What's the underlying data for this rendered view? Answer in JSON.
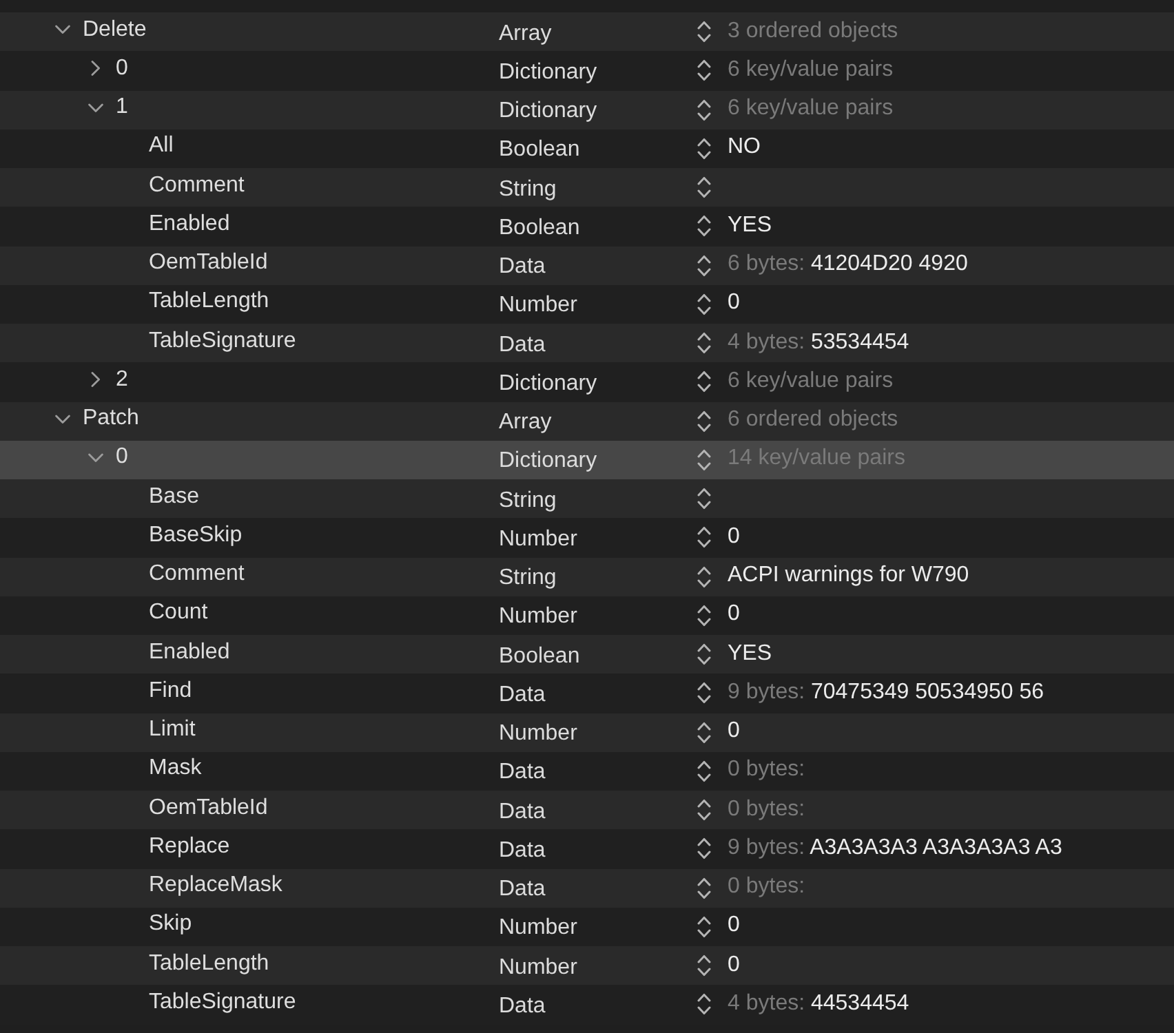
{
  "outline": {
    "rows": [
      {
        "key": "Delete",
        "type": "Array",
        "summary": "3 ordered objects",
        "expanded": true,
        "selected": false,
        "children": [
          {
            "key": "0",
            "type": "Dictionary",
            "summary": "6 key/value pairs",
            "expanded": false,
            "selected": false
          },
          {
            "key": "1",
            "type": "Dictionary",
            "summary": "6 key/value pairs",
            "expanded": true,
            "selected": false,
            "children": [
              {
                "key": "All",
                "type": "Boolean",
                "value": "NO",
                "selected": false
              },
              {
                "key": "Comment",
                "type": "String",
                "selected": false
              },
              {
                "key": "Enabled",
                "type": "Boolean",
                "value": "YES",
                "selected": false
              },
              {
                "key": "OemTableId",
                "type": "Data",
                "byte_count": "6 bytes:",
                "value": "41204D20 4920",
                "selected": false
              },
              {
                "key": "TableLength",
                "type": "Number",
                "value": "0",
                "selected": false
              },
              {
                "key": "TableSignature",
                "type": "Data",
                "byte_count": "4 bytes:",
                "value": "53534454",
                "selected": false
              }
            ]
          },
          {
            "key": "2",
            "type": "Dictionary",
            "summary": "6 key/value pairs",
            "expanded": false,
            "selected": false
          }
        ]
      },
      {
        "key": "Patch",
        "type": "Array",
        "summary": "6 ordered objects",
        "expanded": true,
        "selected": false,
        "children": [
          {
            "key": "0",
            "type": "Dictionary",
            "summary": "14 key/value pairs",
            "expanded": true,
            "selected": true,
            "children": [
              {
                "key": "Base",
                "type": "String",
                "selected": false
              },
              {
                "key": "BaseSkip",
                "type": "Number",
                "value": "0",
                "selected": false
              },
              {
                "key": "Comment",
                "type": "String",
                "value": "ACPI warnings for W790",
                "selected": false
              },
              {
                "key": "Count",
                "type": "Number",
                "value": "0",
                "selected": false
              },
              {
                "key": "Enabled",
                "type": "Boolean",
                "value": "YES",
                "selected": false
              },
              {
                "key": "Find",
                "type": "Data",
                "byte_count": "9 bytes:",
                "value": "70475349 50534950 56",
                "selected": false
              },
              {
                "key": "Limit",
                "type": "Number",
                "value": "0",
                "selected": false
              },
              {
                "key": "Mask",
                "type": "Data",
                "byte_count": "0 bytes:",
                "selected": false
              },
              {
                "key": "OemTableId",
                "type": "Data",
                "byte_count": "0 bytes:",
                "selected": false
              },
              {
                "key": "Replace",
                "type": "Data",
                "byte_count": "9 bytes:",
                "value": "A3A3A3A3 A3A3A3A3 A3",
                "selected": false
              },
              {
                "key": "ReplaceMask",
                "type": "Data",
                "byte_count": "0 bytes:",
                "selected": false
              },
              {
                "key": "Skip",
                "type": "Number",
                "value": "0",
                "selected": false
              },
              {
                "key": "TableLength",
                "type": "Number",
                "value": "0",
                "selected": false
              },
              {
                "key": "TableSignature",
                "type": "Data",
                "byte_count": "4 bytes:",
                "value": "44534454",
                "selected": false
              }
            ]
          }
        ]
      }
    ]
  }
}
